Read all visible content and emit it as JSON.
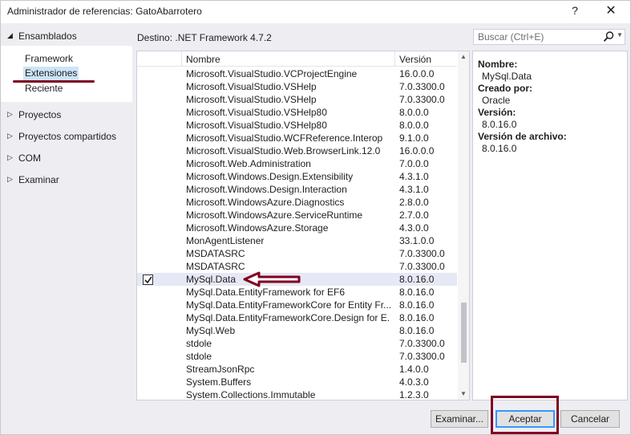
{
  "window": {
    "title": "Administrador de referencias: GatoAbarrotero",
    "help_glyph": "?",
    "close_glyph": "✕"
  },
  "nav": {
    "groups": [
      {
        "label": "Ensamblados",
        "expanded": true
      },
      {
        "label": "Proyectos",
        "expanded": false
      },
      {
        "label": "Proyectos compartidos",
        "expanded": false
      },
      {
        "label": "COM",
        "expanded": false
      },
      {
        "label": "Examinar",
        "expanded": false
      }
    ],
    "sub_items": [
      {
        "label": "Framework",
        "selected": false
      },
      {
        "label": "Extensiones",
        "selected": true
      },
      {
        "label": "Reciente",
        "selected": false
      }
    ]
  },
  "target": "Destino: .NET Framework 4.7.2",
  "search": {
    "placeholder": "Buscar (Ctrl+E)",
    "value": ""
  },
  "list": {
    "columns": {
      "name": "Nombre",
      "version": "Versión"
    },
    "rows": [
      {
        "name": "Microsoft.VisualStudio.VCProjectEngine",
        "version": "16.0.0.0",
        "checked": false
      },
      {
        "name": "Microsoft.VisualStudio.VSHelp",
        "version": "7.0.3300.0",
        "checked": false
      },
      {
        "name": "Microsoft.VisualStudio.VSHelp",
        "version": "7.0.3300.0",
        "checked": false
      },
      {
        "name": "Microsoft.VisualStudio.VSHelp80",
        "version": "8.0.0.0",
        "checked": false
      },
      {
        "name": "Microsoft.VisualStudio.VSHelp80",
        "version": "8.0.0.0",
        "checked": false
      },
      {
        "name": "Microsoft.VisualStudio.WCFReference.Interop",
        "version": "9.1.0.0",
        "checked": false
      },
      {
        "name": "Microsoft.VisualStudio.Web.BrowserLink.12.0",
        "version": "16.0.0.0",
        "checked": false
      },
      {
        "name": "Microsoft.Web.Administration",
        "version": "7.0.0.0",
        "checked": false
      },
      {
        "name": "Microsoft.Windows.Design.Extensibility",
        "version": "4.3.1.0",
        "checked": false
      },
      {
        "name": "Microsoft.Windows.Design.Interaction",
        "version": "4.3.1.0",
        "checked": false
      },
      {
        "name": "Microsoft.WindowsAzure.Diagnostics",
        "version": "2.8.0.0",
        "checked": false
      },
      {
        "name": "Microsoft.WindowsAzure.ServiceRuntime",
        "version": "2.7.0.0",
        "checked": false
      },
      {
        "name": "Microsoft.WindowsAzure.Storage",
        "version": "4.3.0.0",
        "checked": false
      },
      {
        "name": "MonAgentListener",
        "version": "33.1.0.0",
        "checked": false
      },
      {
        "name": "MSDATASRC",
        "version": "7.0.3300.0",
        "checked": false
      },
      {
        "name": "MSDATASRC",
        "version": "7.0.3300.0",
        "checked": false
      },
      {
        "name": "MySql.Data",
        "version": "8.0.16.0",
        "checked": true
      },
      {
        "name": "MySql.Data.EntityFramework for EF6",
        "version": "8.0.16.0",
        "checked": false
      },
      {
        "name": "MySql.Data.EntityFrameworkCore for Entity Fr...",
        "version": "8.0.16.0",
        "checked": false
      },
      {
        "name": "MySql.Data.EntityFrameworkCore.Design for E...",
        "version": "8.0.16.0",
        "checked": false
      },
      {
        "name": "MySql.Web",
        "version": "8.0.16.0",
        "checked": false
      },
      {
        "name": "stdole",
        "version": "7.0.3300.0",
        "checked": false
      },
      {
        "name": "stdole",
        "version": "7.0.3300.0",
        "checked": false
      },
      {
        "name": "StreamJsonRpc",
        "version": "1.4.0.0",
        "checked": false
      },
      {
        "name": "System.Buffers",
        "version": "4.0.3.0",
        "checked": false
      },
      {
        "name": "System.Collections.Immutable",
        "version": "1.2.3.0",
        "checked": false
      }
    ]
  },
  "details": {
    "name_label": "Nombre:",
    "name_value": "MySql.Data",
    "created_label": "Creado por:",
    "created_value": "Oracle",
    "version_label": "Versión:",
    "version_value": "8.0.16.0",
    "file_version_label": "Versión de archivo:",
    "file_version_value": "8.0.16.0"
  },
  "buttons": {
    "browse": "Examinar...",
    "ok": "Aceptar",
    "cancel": "Cancelar"
  },
  "colors": {
    "annotation": "#800020",
    "selection": "#cce4f7",
    "row_highlight": "#e6e8f5"
  }
}
